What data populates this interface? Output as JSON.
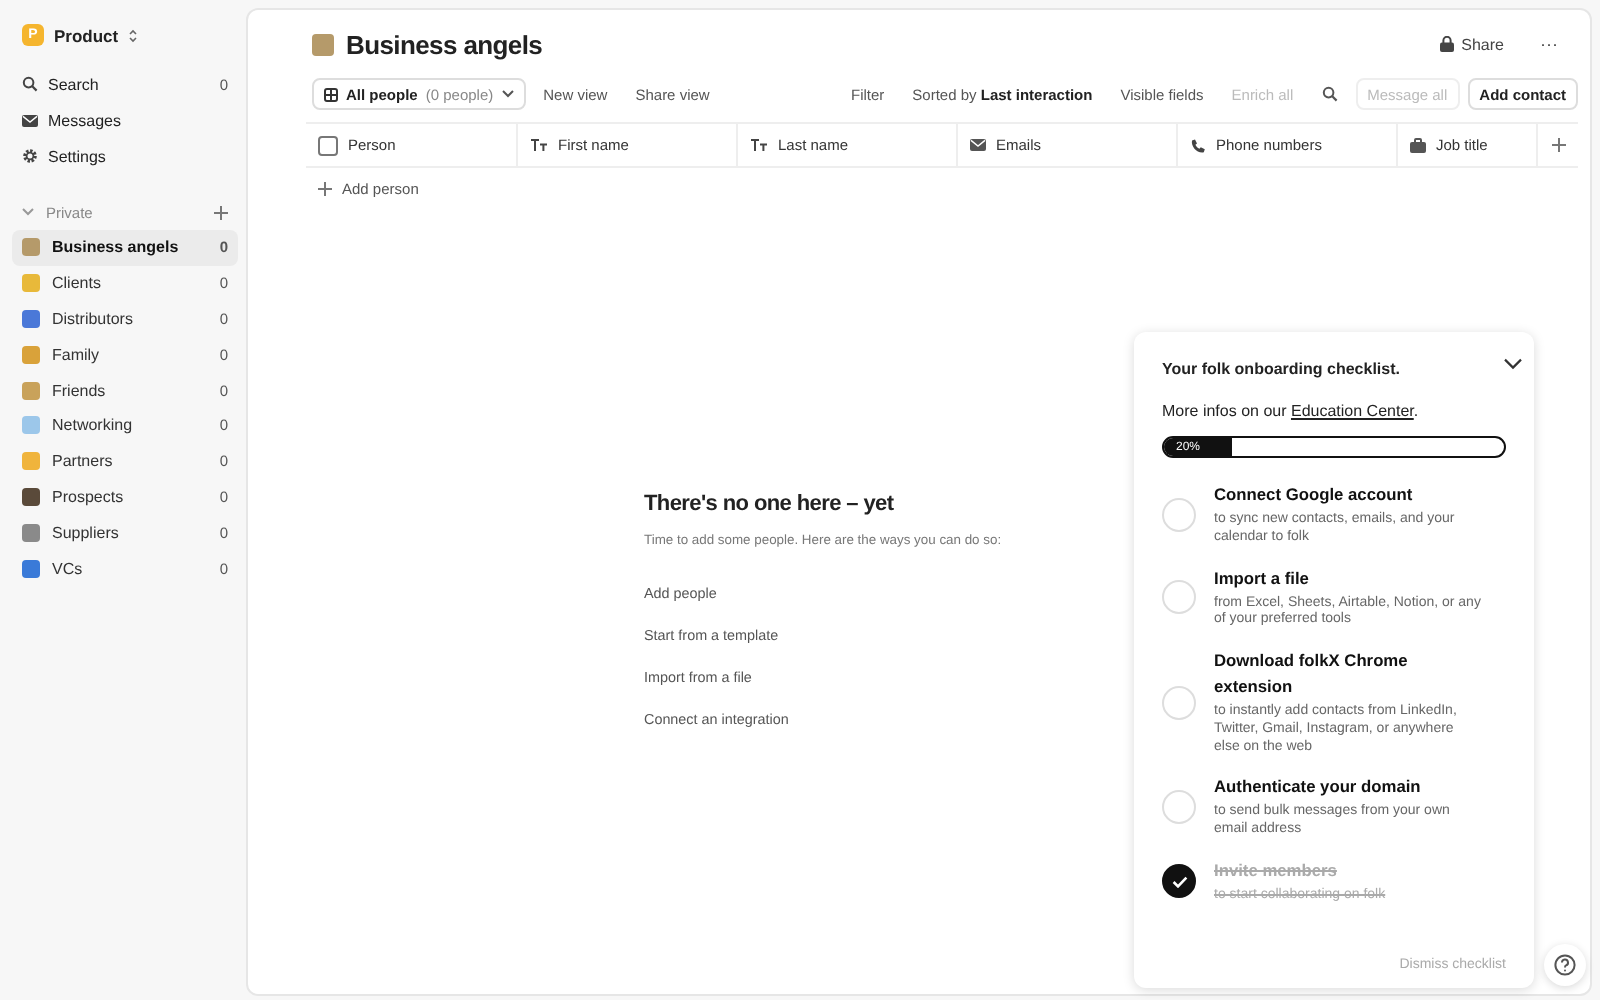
{
  "sidebar": {
    "workspace": {
      "badge": "P",
      "name": "Product"
    },
    "nav": [
      {
        "kind": "search",
        "label": "Search",
        "count": "0"
      },
      {
        "kind": "messages",
        "label": "Messages"
      },
      {
        "kind": "settings",
        "label": "Settings"
      }
    ],
    "section": {
      "label": "Private",
      "expanded": true
    },
    "groups": [
      {
        "label": "Business angels",
        "count": "0",
        "selected": true,
        "color": "#b59a6a"
      },
      {
        "label": "Clients",
        "count": "0",
        "selected": false,
        "color": "#e8b93a"
      },
      {
        "label": "Distributors",
        "count": "0",
        "selected": false,
        "color": "#4a78d8"
      },
      {
        "label": "Family",
        "count": "0",
        "selected": false,
        "color": "#d9a23a"
      },
      {
        "label": "Friends",
        "count": "0",
        "selected": false,
        "color": "#c9a25a"
      },
      {
        "label": "Networking",
        "count": "0",
        "selected": false,
        "color": "#9cc7ea"
      },
      {
        "label": "Partners",
        "count": "0",
        "selected": false,
        "color": "#f0b43c"
      },
      {
        "label": "Prospects",
        "count": "0",
        "selected": false,
        "color": "#5a4a3a"
      },
      {
        "label": "Suppliers",
        "count": "0",
        "selected": false,
        "color": "#8a8a8a"
      },
      {
        "label": "VCs",
        "count": "0",
        "selected": false,
        "color": "#3a7ad8"
      }
    ]
  },
  "header": {
    "title": "Business angels",
    "share": "Share",
    "more": "···"
  },
  "toolbar": {
    "view": {
      "label": "All people",
      "count": "(0 people)"
    },
    "left_buttons": [
      {
        "label": "New view"
      },
      {
        "label": "Share view"
      }
    ],
    "right_buttons": [
      {
        "label": "Filter",
        "disabled": false
      },
      {
        "label": "Sorted by **Last interaction**",
        "disabled": false
      },
      {
        "label": "Visible fields",
        "disabled": false
      },
      {
        "label": "Enrich all",
        "disabled": true
      }
    ],
    "message_all": {
      "label": "Message all",
      "disabled": true
    },
    "add_contact": "Add contact"
  },
  "table": {
    "columns": [
      {
        "kind": "checkbox",
        "label": "Person",
        "checked": false
      },
      {
        "kind": "text",
        "label": "First name"
      },
      {
        "kind": "text",
        "label": "Last name"
      },
      {
        "kind": "email",
        "label": "Emails"
      },
      {
        "kind": "phone",
        "label": "Phone numbers"
      },
      {
        "kind": "job",
        "label": "Job title"
      }
    ],
    "add_row": "Add person"
  },
  "empty_state": {
    "title": "There's no one here – yet",
    "subtitle": "Time to add some people. Here are the ways you can do so:",
    "actions": [
      "Add people",
      "Start from a template",
      "Import from a file",
      "Connect an integration"
    ]
  },
  "checklist": {
    "title": "Your folk onboarding checklist.",
    "info_prefix": "More infos on our ",
    "info_link": "Education Center",
    "info_suffix": ".",
    "progress": {
      "level": 0.2,
      "label": "20%"
    },
    "items": [
      {
        "title": "Connect Google account",
        "description": "to sync new contacts, emails, and your calendar to folk",
        "checked": false
      },
      {
        "title": "Import a file",
        "description": "from Excel, Sheets, Airtable, Notion, or any of your preferred tools",
        "checked": false
      },
      {
        "title": "Download folkX Chrome extension",
        "description": "to instantly add contacts from LinkedIn, Twitter, Gmail, Instagram, or anywhere else on the web",
        "checked": false
      },
      {
        "title": "Authenticate your domain",
        "description": "to send bulk messages from your own email address",
        "checked": false
      },
      {
        "title": "Invite members",
        "description": "to start collaborating on folk",
        "checked": true
      }
    ],
    "dismiss": "Dismiss checklist"
  }
}
